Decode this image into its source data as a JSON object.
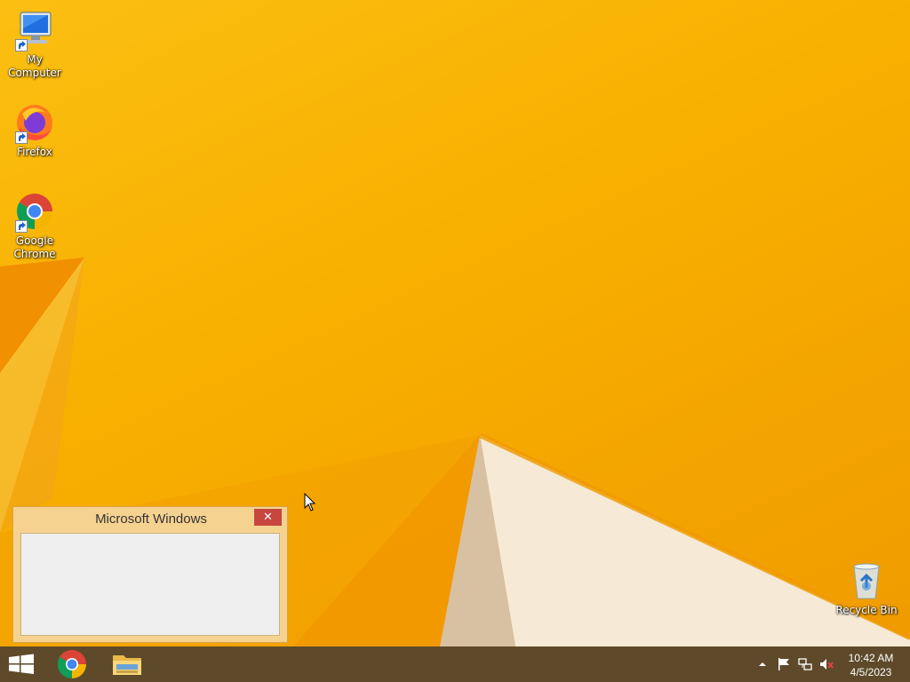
{
  "desktop": {
    "icons": [
      {
        "label": "My Computer",
        "icon": "computer-icon"
      },
      {
        "label": "Firefox",
        "icon": "firefox-icon"
      },
      {
        "label": "Google Chrome",
        "icon": "chrome-icon"
      },
      {
        "label": "Recycle Bin",
        "icon": "recycle-bin-icon"
      }
    ]
  },
  "dialog": {
    "title": "Microsoft Windows",
    "close_label": "✕"
  },
  "taskbar": {
    "buttons": [
      {
        "name": "start",
        "icon": "windows-logo-icon"
      },
      {
        "name": "chrome",
        "icon": "chrome-icon"
      },
      {
        "name": "file-explorer",
        "icon": "folder-icon"
      }
    ],
    "tray": {
      "icons": [
        "show-hidden-icons-chevron",
        "action-center-flag-icon",
        "network-icon",
        "volume-muted-icon"
      ],
      "time": "10:42 AM",
      "date": "4/5/2023"
    }
  },
  "colors": {
    "wallpaper": "#f7b400",
    "taskbar": "#5e4a2a",
    "dialog_frame": "#f6d291",
    "close_button": "#c7463e"
  }
}
